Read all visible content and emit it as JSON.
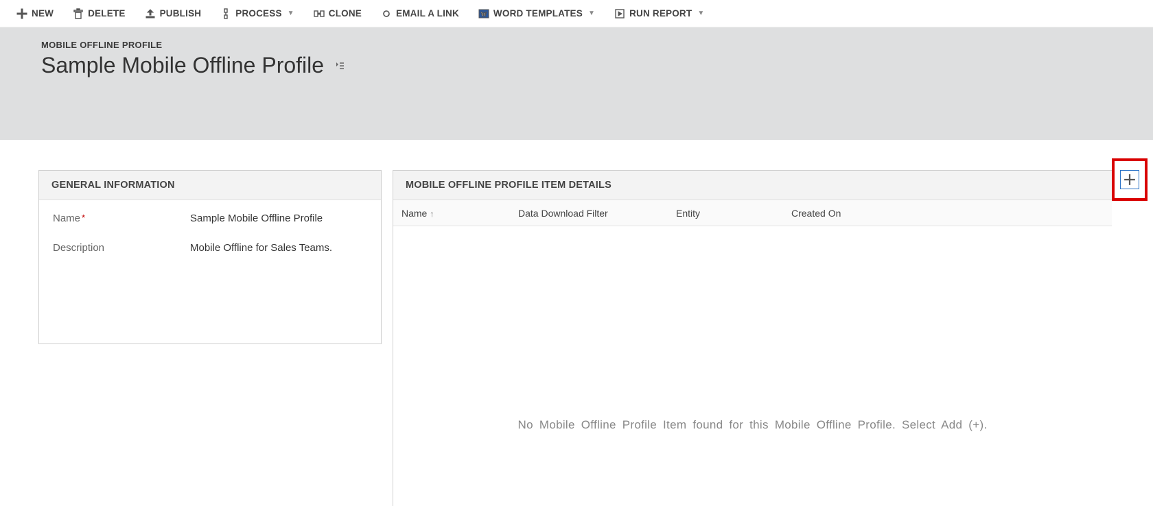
{
  "commands": {
    "new": "NEW",
    "delete": "DELETE",
    "publish": "PUBLISH",
    "process": "PROCESS",
    "clone": "CLONE",
    "emailLink": "EMAIL A LINK",
    "wordTemplates": "WORD TEMPLATES",
    "runReport": "RUN REPORT"
  },
  "header": {
    "breadcrumb": "MOBILE OFFLINE PROFILE",
    "title": "Sample Mobile Offline Profile"
  },
  "general": {
    "sectionTitle": "GENERAL INFORMATION",
    "nameLabel": "Name",
    "nameValue": "Sample Mobile Offline Profile",
    "descriptionLabel": "Description",
    "descriptionValue": "Mobile Offline for Sales Teams."
  },
  "details": {
    "sectionTitle": "MOBILE OFFLINE PROFILE ITEM DETAILS",
    "columns": {
      "name": "Name",
      "filter": "Data Download Filter",
      "entity": "Entity",
      "created": "Created On"
    },
    "emptyMessage": "No Mobile Offline Profile Item found for this Mobile Offline Profile. Select Add (+)."
  }
}
